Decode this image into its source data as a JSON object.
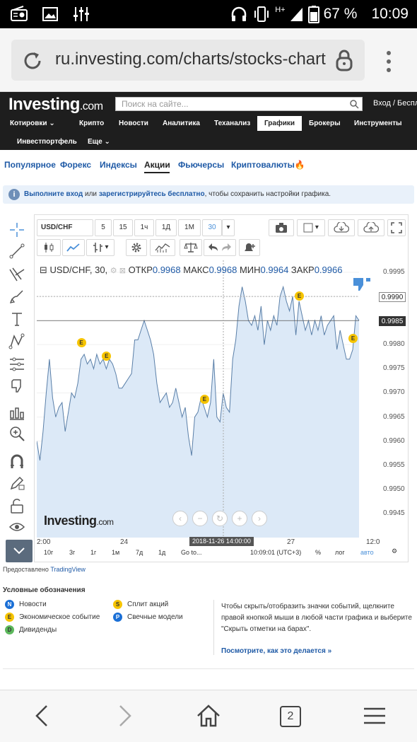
{
  "status_bar": {
    "battery": "67 %",
    "time": "10:09",
    "network": "H+"
  },
  "browser": {
    "url": "ru.investing.com/charts/stocks-chart"
  },
  "header": {
    "logo_main": "Investing",
    "logo_suffix": ".com",
    "search_placeholder": "Поиск на сайте...",
    "login": "Вход / Беспл",
    "nav1": [
      "Котировки",
      "Крипто",
      "Новости",
      "Аналитика",
      "Теханализ",
      "Графики",
      "Брокеры",
      "Инструменты"
    ],
    "nav1_active": "Графики",
    "nav2": [
      "Инвестпортфель",
      "Еще"
    ]
  },
  "tabs": {
    "items": [
      "Популярное",
      "Форекс",
      "Индексы",
      "Акции",
      "Фьючерсы",
      "Криптовалюты"
    ],
    "active": "Акции"
  },
  "banner": {
    "icon": "i",
    "link1": "Выполните вход",
    "mid": " или ",
    "link2": "зарегистрируйтесь бесплатно",
    "tail": ", чтобы сохранить настройки графика."
  },
  "chart_toolbar": {
    "symbol": "USD/CHF",
    "intervals": [
      "5",
      "15",
      "1ч",
      "1Д",
      "1М",
      "30"
    ],
    "active_interval": "30"
  },
  "chart_legend": {
    "symbol": "USD/CHF, 30,",
    "open_label": "ОТКР",
    "open": "0.9968",
    "high_label": "МАКС",
    "high": "0.9968",
    "low_label": "МИН",
    "low": "0.9964",
    "close_label": "ЗАКР",
    "close": "0.9966"
  },
  "chart_data": {
    "type": "area",
    "title": "USD/CHF, 30",
    "x_ticks": [
      "2:00",
      "24",
      "27",
      "12:0"
    ],
    "y_ticks": [
      "0.9995",
      "0.9990",
      "0.9985",
      "0.9980",
      "0.9975",
      "0.9970",
      "0.9965",
      "0.9960",
      "0.9955",
      "0.9950",
      "0.9945"
    ],
    "ylim": [
      0.994,
      0.99975
    ],
    "highlighted_prices": [
      "0.9990",
      "0.9985"
    ],
    "crosshair_time": "2018-11-26 14:00:00",
    "series": [
      {
        "values": [
          0.996,
          0.9956,
          0.9962,
          0.997,
          0.9977,
          0.9969,
          0.9965,
          0.9967,
          0.9968,
          0.9962,
          0.9966,
          0.997,
          0.9969,
          0.9972,
          0.9977,
          0.9978,
          0.9976,
          0.9977,
          0.9975,
          0.9978,
          0.9976,
          0.9977,
          0.9975,
          0.9977,
          0.9976,
          0.9974,
          0.9971,
          0.9971,
          0.9972,
          0.9973,
          0.9974,
          0.9981,
          0.9981,
          0.9983,
          0.9985,
          0.9983,
          0.9981,
          0.9978,
          0.9972,
          0.9968,
          0.9969,
          0.997,
          0.9967,
          0.9968,
          0.9971,
          0.9968,
          0.9965,
          0.9967,
          0.9961,
          0.9957,
          0.9965,
          0.9966,
          0.9969,
          0.9967,
          0.9965,
          0.9968,
          0.9977,
          0.9965,
          0.9964,
          0.997,
          0.9967,
          0.9966,
          0.9977,
          0.9981,
          0.9988,
          0.9992,
          0.9989,
          0.9985,
          0.9984,
          0.9986,
          0.9983,
          0.9988,
          0.998,
          0.9985,
          0.9983,
          0.9986,
          0.9984,
          0.999,
          0.9992,
          0.9989,
          0.9987,
          0.999,
          0.9982,
          0.9989,
          0.9986,
          0.9983,
          0.9985,
          0.9982,
          0.9985,
          0.9983,
          0.9986,
          0.9982,
          0.9984,
          0.9985,
          0.9986,
          0.9979,
          0.9983,
          0.998,
          0.9977,
          0.9977,
          0.9979,
          0.9986,
          0.9985
        ]
      }
    ]
  },
  "chart_events": [
    "E",
    "E",
    "E",
    "E",
    "E"
  ],
  "chart_watermark": {
    "main": "Investing",
    "suffix": ".com"
  },
  "bottom_toolbar": {
    "ranges": [
      "10г",
      "3г",
      "1г",
      "1м",
      "7д",
      "1д",
      "Go to..."
    ],
    "time": "10:09:01 (UTC+3)",
    "percent": "%",
    "log": "лог",
    "auto": "авто"
  },
  "powered": {
    "prefix": "Предоставлено ",
    "brand": "TradingView"
  },
  "legend_section": {
    "title": "Условные обозначения",
    "items": [
      {
        "letter": "N",
        "label": "Новости",
        "color": "#1a6fd6"
      },
      {
        "letter": "E",
        "label": "Экономическое событие",
        "color": "#f6c400"
      },
      {
        "letter": "D",
        "label": "Дивиденды",
        "color": "#5cb85c"
      },
      {
        "letter": "S",
        "label": "Сплит акций",
        "color": "#f6c400"
      },
      {
        "letter": "P",
        "label": "Свечные модели",
        "color": "#1a6fd6"
      }
    ],
    "note": "Чтобы скрыть/отобразить значки событий, щелкните правой кнопкой мыши в любой части графика и выберите \"Скрыть отметки на барах\".",
    "link": "Посмотрите, как это делается »"
  },
  "bottom_nav": {
    "tabs_count": "2"
  },
  "colors": {
    "accent": "#1f5aa6",
    "area_fill": "#dce9f7",
    "line": "#5a7fa8",
    "header_bg": "#1e1e1e",
    "event": "#f6c400"
  }
}
